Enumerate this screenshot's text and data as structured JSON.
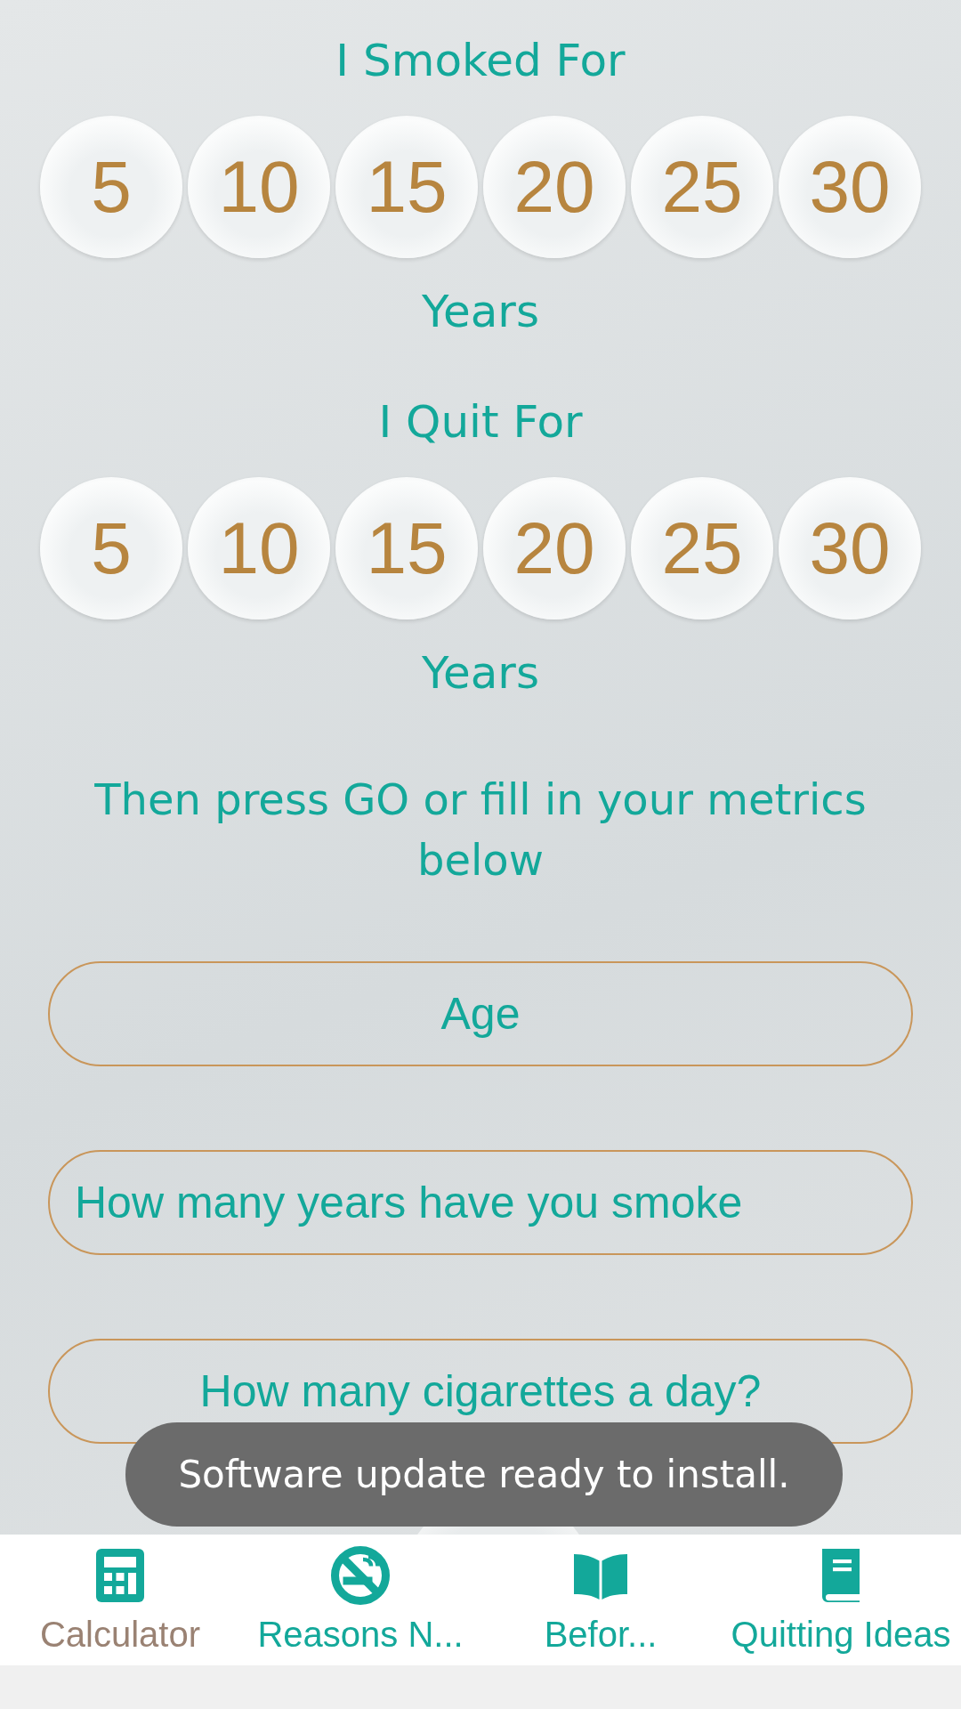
{
  "smoked": {
    "title": "I Smoked For",
    "options": [
      {
        "label": "5"
      },
      {
        "label": "10"
      },
      {
        "label": "15"
      },
      {
        "label": "20"
      },
      {
        "label": "25"
      },
      {
        "label": "30"
      }
    ],
    "unit": "Years"
  },
  "quit": {
    "title": "I Quit For",
    "options": [
      {
        "label": "5"
      },
      {
        "label": "10"
      },
      {
        "label": "15"
      },
      {
        "label": "20"
      },
      {
        "label": "25"
      },
      {
        "label": "30"
      }
    ],
    "unit": "Years"
  },
  "instruction": "Then press GO or fill in your metrics below",
  "fields": [
    {
      "placeholder": "Age"
    },
    {
      "placeholder": "How many years have you smoke"
    },
    {
      "placeholder": "How many cigarettes a day?"
    }
  ],
  "toast": "Software update ready to install.",
  "nav": [
    {
      "label": "Calculator",
      "selected": true
    },
    {
      "label": "Reasons N...",
      "selected": false
    },
    {
      "label": "Befor...",
      "selected": false
    },
    {
      "label": "Quitting Ideas",
      "selected": false
    }
  ]
}
